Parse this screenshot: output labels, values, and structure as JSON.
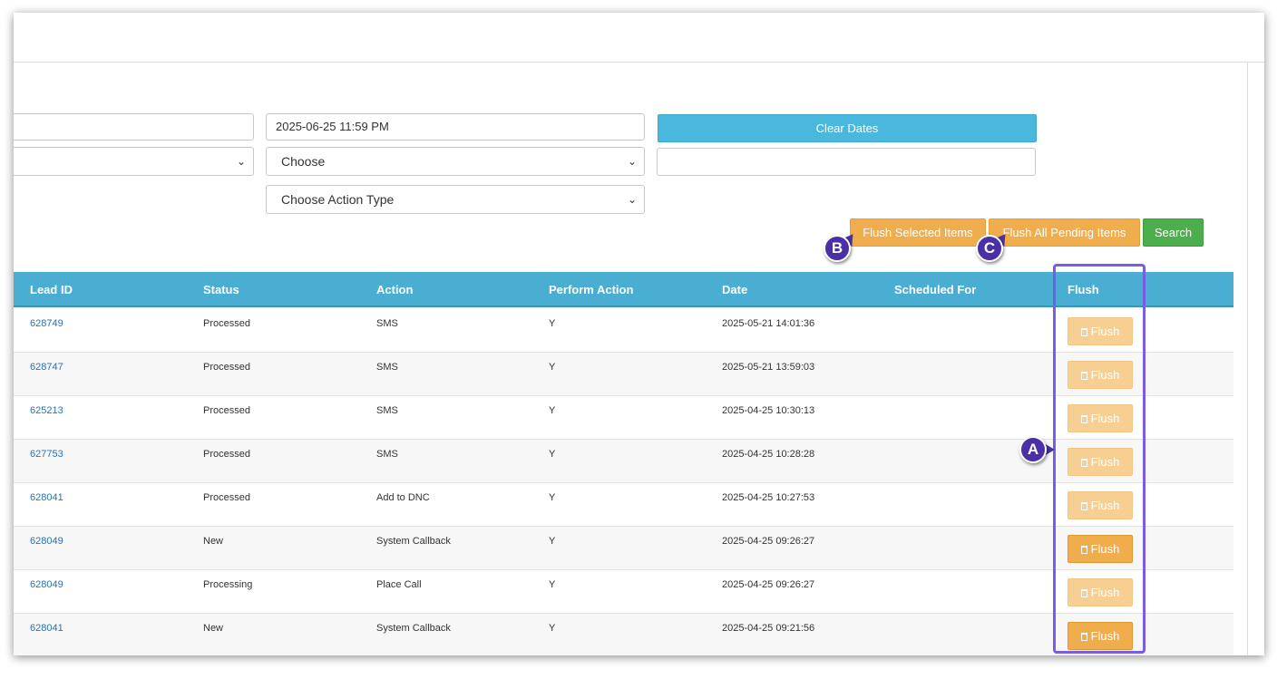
{
  "filters": {
    "end_date_value": "2025-06-25 11:59 PM",
    "clear_dates_label": "Clear Dates",
    "choose_select_value": "Choose",
    "action_type_select_value": "Choose Action Type",
    "text_search_value": ""
  },
  "toolbar": {
    "flush_selected_label": "Flush Selected Items",
    "flush_all_pending_label": "Flush All Pending Items",
    "search_label": "Search"
  },
  "table": {
    "headers": [
      "Lead ID",
      "Status",
      "Action",
      "Perform Action",
      "Date",
      "Scheduled For",
      "Flush"
    ],
    "flush_label": "Flush",
    "rows": [
      {
        "lead_id": "628749",
        "status": "Processed",
        "action": "SMS",
        "perform": "Y",
        "date": "2025-05-21 14:01:36",
        "scheduled": "",
        "flush_enabled": false
      },
      {
        "lead_id": "628747",
        "status": "Processed",
        "action": "SMS",
        "perform": "Y",
        "date": "2025-05-21 13:59:03",
        "scheduled": "",
        "flush_enabled": false
      },
      {
        "lead_id": "625213",
        "status": "Processed",
        "action": "SMS",
        "perform": "Y",
        "date": "2025-04-25 10:30:13",
        "scheduled": "",
        "flush_enabled": false
      },
      {
        "lead_id": "627753",
        "status": "Processed",
        "action": "SMS",
        "perform": "Y",
        "date": "2025-04-25 10:28:28",
        "scheduled": "",
        "flush_enabled": false
      },
      {
        "lead_id": "628041",
        "status": "Processed",
        "action": "Add to DNC",
        "perform": "Y",
        "date": "2025-04-25 10:27:53",
        "scheduled": "",
        "flush_enabled": false
      },
      {
        "lead_id": "628049",
        "status": "New",
        "action": "System Callback",
        "perform": "Y",
        "date": "2025-04-25 09:26:27",
        "scheduled": "",
        "flush_enabled": true
      },
      {
        "lead_id": "628049",
        "status": "Processing",
        "action": "Place Call",
        "perform": "Y",
        "date": "2025-04-25 09:26:27",
        "scheduled": "",
        "flush_enabled": false
      },
      {
        "lead_id": "628041",
        "status": "New",
        "action": "System Callback",
        "perform": "Y",
        "date": "2025-04-25 09:21:56",
        "scheduled": "",
        "flush_enabled": true
      }
    ]
  },
  "annotations": {
    "a": "A",
    "b": "B",
    "c": "C"
  },
  "colors": {
    "header_bg": "#4aaed2",
    "warning": "#f0ad4e",
    "info": "#49b8dc",
    "success": "#4cae4c",
    "annotation": "#4a2fa6",
    "highlight_border": "#7b5ce6"
  }
}
